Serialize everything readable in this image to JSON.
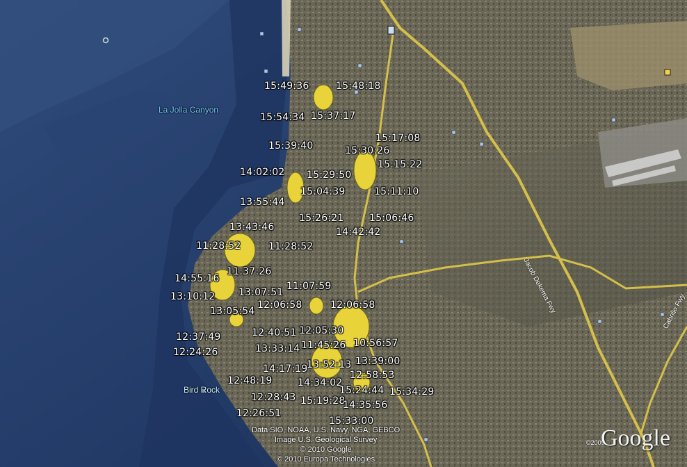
{
  "map": {
    "places": [
      {
        "name": "La Jolla Canyon",
        "color": "#6fc6ff"
      },
      {
        "name": "Bird Rock",
        "color": "#c7efff"
      }
    ],
    "roads": [
      {
        "name": "Jacob Dekema Fwy"
      },
      {
        "name": "Cabrillo Fwy"
      }
    ],
    "labels": [
      "15:49:36",
      "15:48:18",
      "15:54:34",
      "15:37:17",
      "15:17:08",
      "15:39:40",
      "15:30:26",
      "15:15:22",
      "14:02:02",
      "15:29:50",
      "15:04:39",
      "15:11:10",
      "13:55:44",
      "15:26:21",
      "15:06:46",
      "14:42:42",
      "13:43:46",
      "11:28:52",
      "11:28:52",
      "11:37:26",
      "14:55:16",
      "13:07:51",
      "11:07:59",
      "13:10:12",
      "12:06:58",
      "12:06:58",
      "13:05:54",
      "12:40:51",
      "12:05:30",
      "12:37:49",
      "10:56:57",
      "11:45:26",
      "13:33:14",
      "12:24:26",
      "13:39:00",
      "14:17:19",
      "13:52:13",
      "12:58:53",
      "12:48:19",
      "14:34:02",
      "15:24:44",
      "15:34:29",
      "12:28:43",
      "15:19:28",
      "14:35:56",
      "12:26:51",
      "15:33:00"
    ],
    "credits": [
      "Data SIO, NOAA, U.S. Navy, NGA, GEBCO",
      "Image U.S. Geological Survey",
      "© 2010 Google",
      "© 2010 Europa Technologies"
    ],
    "copyright_year": "©2009",
    "logo": "Google"
  }
}
